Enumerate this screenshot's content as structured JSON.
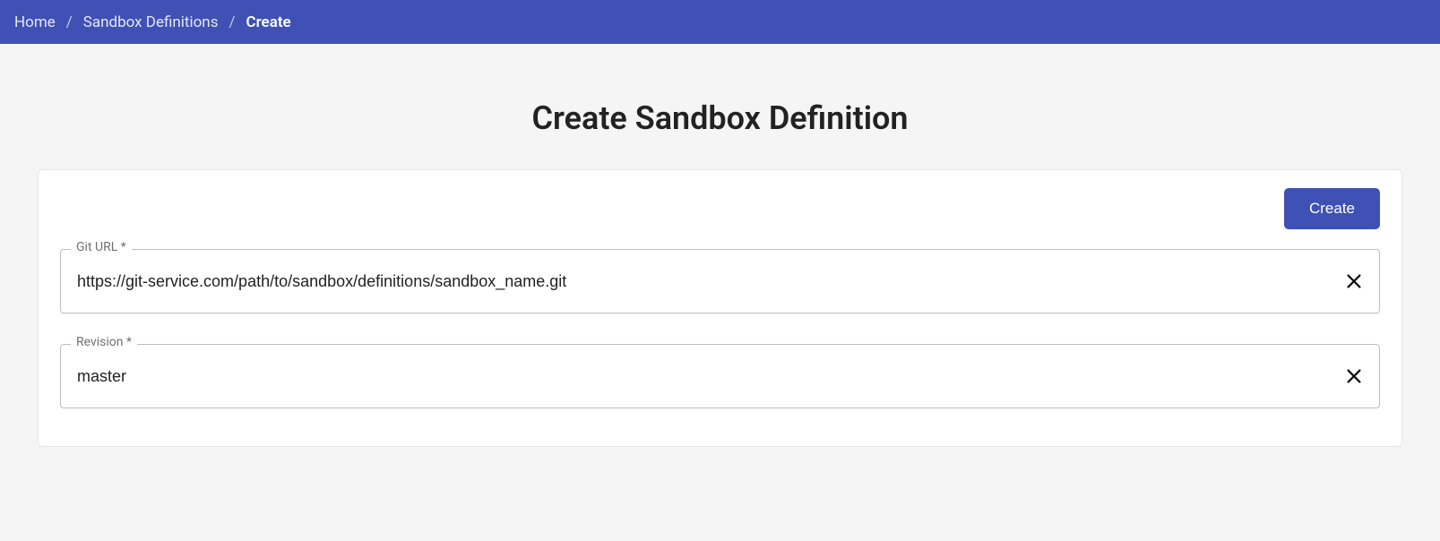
{
  "breadcrumb": {
    "items": [
      {
        "label": "Home"
      },
      {
        "label": "Sandbox Definitions"
      },
      {
        "label": "Create"
      }
    ],
    "separator": "/"
  },
  "page": {
    "title": "Create Sandbox Definition"
  },
  "actions": {
    "create_label": "Create"
  },
  "form": {
    "git_url": {
      "label": "Git URL *",
      "value": "https://git-service.com/path/to/sandbox/definitions/sandbox_name.git"
    },
    "revision": {
      "label": "Revision *",
      "value": "master"
    }
  }
}
